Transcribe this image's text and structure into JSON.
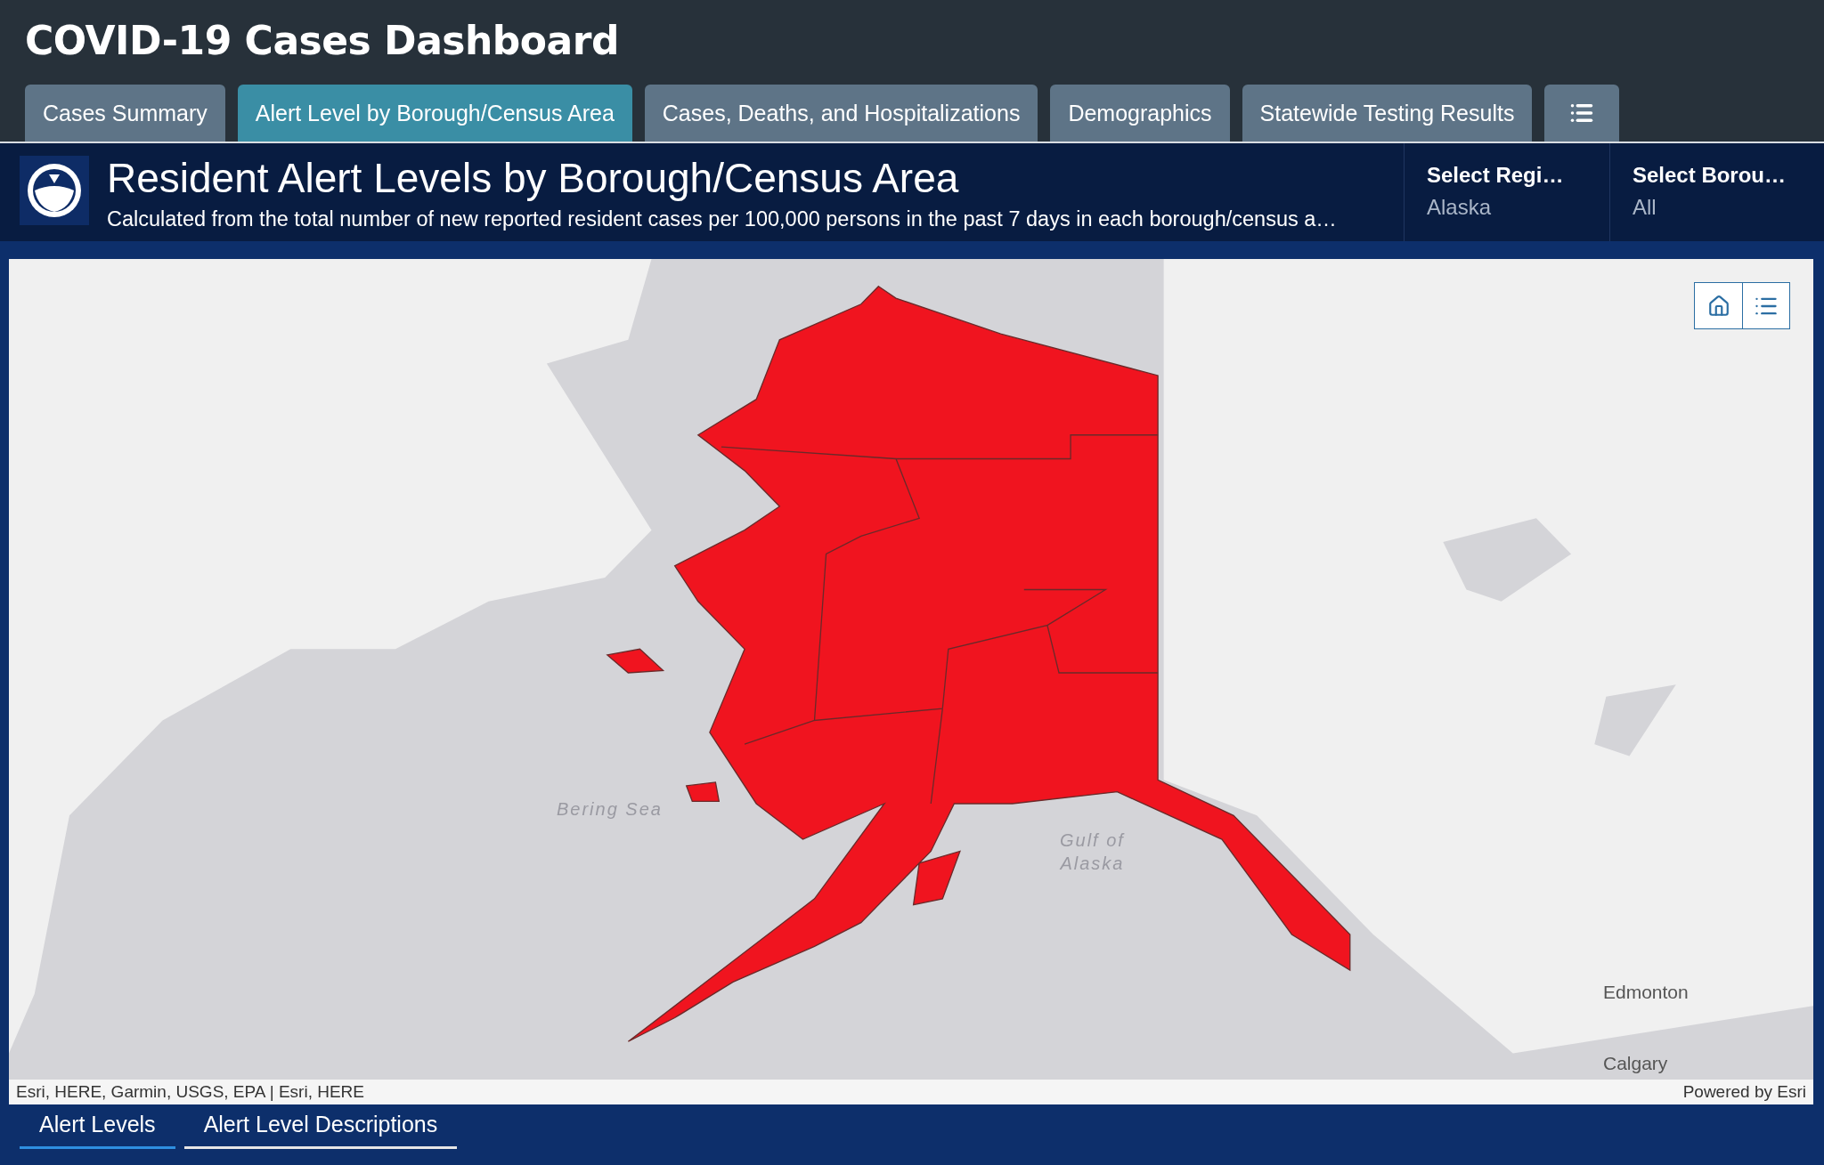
{
  "header": {
    "title": "COVID-19 Cases Dashboard"
  },
  "tabs": [
    {
      "label": "Cases Summary",
      "selected": false,
      "kind": "text"
    },
    {
      "label": "Alert Level by Borough/Census Area",
      "selected": true,
      "kind": "text"
    },
    {
      "label": "Cases, Deaths, and Hospitalizations",
      "selected": false,
      "kind": "text"
    },
    {
      "label": "Demographics",
      "selected": false,
      "kind": "text"
    },
    {
      "label": "Statewide Testing Results",
      "selected": false,
      "kind": "text"
    },
    {
      "selected": false,
      "kind": "icon"
    }
  ],
  "panel": {
    "title": "Resident Alert Levels by Borough/Census Area",
    "description": "Calculated from the total number of new reported resident cases per 100,000 persons in the past 7 days in each borough/census a…",
    "selectors": [
      {
        "label": "Select Regi…",
        "value": "Alaska"
      },
      {
        "label": "Select Borou…",
        "value": "All"
      }
    ]
  },
  "map": {
    "labels": [
      {
        "text": "Bering Sea",
        "kind": "water"
      },
      {
        "text": "Gulf of\nAlaska",
        "kind": "water"
      },
      {
        "text": "Edmonton",
        "kind": "city"
      },
      {
        "text": "Calgary",
        "kind": "city"
      }
    ],
    "attribution": "Esri, HERE, Garmin, USGS, EPA | Esri, HERE",
    "powered_by": "Powered by Esri"
  },
  "bottom_tabs": [
    {
      "label": "Alert Levels",
      "selected": true
    },
    {
      "label": "Alert Level Descriptions",
      "selected": false
    }
  ]
}
